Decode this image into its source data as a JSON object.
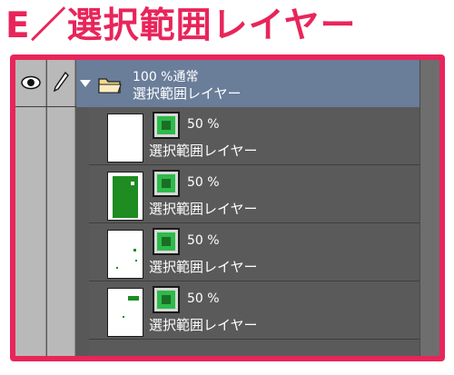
{
  "heading": "E／選択範囲レイヤー",
  "colors": {
    "accent": "#e8255a",
    "folder_highlight": "#6a7d99",
    "mask_green": "#2dbb4a",
    "panel_bg": "#5a5a5a"
  },
  "folder": {
    "opacity_blend": "100 %通常",
    "name": "選択範囲レイヤー",
    "icons": [
      "eye-icon",
      "pen-icon",
      "expand-triangle-icon",
      "folder-icon"
    ]
  },
  "layers": [
    {
      "opacity": "50 %",
      "name": "選択範囲レイヤー"
    },
    {
      "opacity": "50 %",
      "name": "選択範囲レイヤー"
    },
    {
      "opacity": "50 %",
      "name": "選択範囲レイヤー"
    },
    {
      "opacity": "50 %",
      "name": "選択範囲レイヤー"
    }
  ]
}
